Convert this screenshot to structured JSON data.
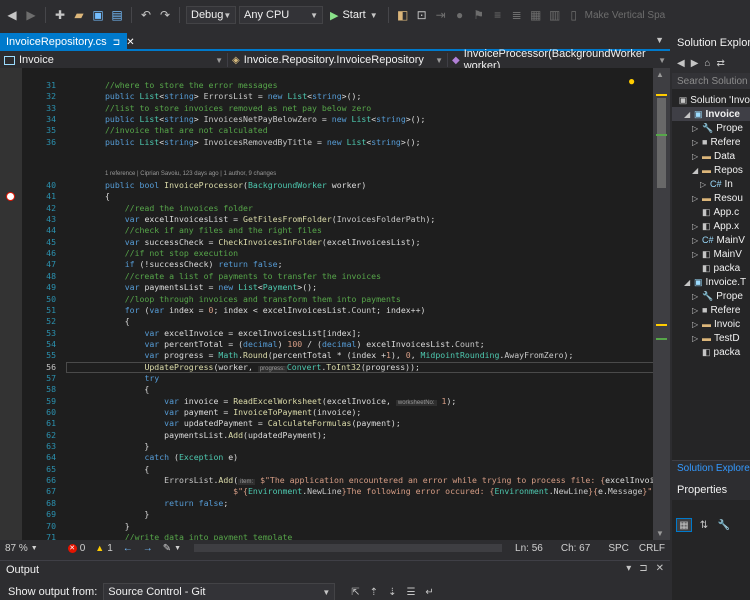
{
  "toolbar": {
    "config": "Debug",
    "platform": "Any CPU",
    "start": "Start",
    "extra": "Make Vertical Spa"
  },
  "tab": {
    "title": "InvoiceRepository.cs"
  },
  "navbar": {
    "project": "Invoice",
    "class": "Invoice.Repository.InvoiceRepository",
    "member": "InvoiceProcessor(BackgroundWorker worker)"
  },
  "editor": {
    "codelens": "1 reference | Ciprian Savoiu, 123 days ago | 1 author, 9 changes",
    "lines": [
      {
        "n": "31",
        "html": "<span class='cm'>//where to store the error messages</span>"
      },
      {
        "n": "32",
        "html": "<span class='kw'>public</span> <span class='ty'>List</span>&lt;<span class='kw'>string</span>&gt; <span class='pr'>ErrorsList</span> = <span class='kw'>new</span> <span class='ty'>List</span>&lt;<span class='kw'>string</span>&gt;();"
      },
      {
        "n": "33",
        "html": "<span class='cm'>//list to store invoices removed as net pay below zero</span>"
      },
      {
        "n": "34",
        "html": "<span class='kw'>public</span> <span class='ty'>List</span>&lt;<span class='kw'>string</span>&gt; <span class='pr'>InvoicesNetPayBelowZero</span> = <span class='kw'>new</span> <span class='ty'>List</span>&lt;<span class='kw'>string</span>&gt;();"
      },
      {
        "n": "35",
        "html": "<span class='cm'>//invoice that are not calculated</span>"
      },
      {
        "n": "36",
        "html": "<span class='kw'>public</span> <span class='ty'>List</span>&lt;<span class='kw'>string</span>&gt; <span class='pr'>InvoicesRemovedByTitle</span> = <span class='kw'>new</span> <span class='ty'>List</span>&lt;<span class='kw'>string</span>&gt;();"
      },
      {
        "n": "37",
        "html": ""
      },
      {
        "n": "38",
        "html": ""
      },
      {
        "n": "39",
        "html": ""
      },
      {
        "n": "40",
        "html": "<span class='kw'>public</span> <span class='kw'>bool</span> <span class='mt'>InvoiceProcessor</span>(<span class='ty'>BackgroundWorker</span> worker)"
      },
      {
        "n": "41",
        "html": "{"
      },
      {
        "n": "42",
        "html": "    <span class='cm'>//read the invoices folder</span>"
      },
      {
        "n": "43",
        "html": "    <span class='kw'>var</span> excelInvoicesList = <span class='mt'>GetFilesFromFolder</span>(<span class='pr'>InvoicesFolderPath</span>);"
      },
      {
        "n": "44",
        "html": "    <span class='cm'>//check if any files and the right files</span>"
      },
      {
        "n": "45",
        "html": "    <span class='kw'>var</span> successCheck = <span class='mt'>CheckInvoicesInFolder</span>(excelInvoicesList);"
      },
      {
        "n": "46",
        "html": "    <span class='cm'>//if not stop execution</span>"
      },
      {
        "n": "47",
        "html": "    <span class='kw'>if</span> (!successCheck) <span class='kw'>return</span> <span class='kw'>false</span>;"
      },
      {
        "n": "48",
        "html": "    <span class='cm'>//create a list of payments to transfer the invoices</span>"
      },
      {
        "n": "49",
        "html": "    <span class='kw'>var</span> paymentsList = <span class='kw'>new</span> <span class='ty'>List</span>&lt;<span class='ty'>Payment</span>&gt;();"
      },
      {
        "n": "50",
        "html": "    <span class='cm'>//loop through invoices and transform them into payments</span>"
      },
      {
        "n": "51",
        "html": "    <span class='kw'>for</span> (<span class='kw'>var</span> index = <span class='st'>0</span>; index &lt; excelInvoicesList.<span class='pr'>Count</span>; index++)"
      },
      {
        "n": "52",
        "html": "    {"
      },
      {
        "n": "53",
        "html": "        <span class='kw'>var</span> excelInvoice = excelInvoicesList[index];"
      },
      {
        "n": "54",
        "html": "        <span class='kw'>var</span> percentTotal = (<span class='kw'>decimal</span>) <span class='st'>100</span> / (<span class='kw'>decimal</span>) excelInvoicesList.<span class='pr'>Count</span>;"
      },
      {
        "n": "55",
        "html": "        <span class='kw'>var</span> progress = <span class='ty'>Math</span>.<span class='mt'>Round</span>(percentTotal * (index +<span class='st'>1</span>), <span class='st'>0</span>, <span class='ty'>MidpointRounding</span>.<span class='pr'>AwayFromZero</span>);"
      },
      {
        "n": "56",
        "html": "        <span class='mt'>UpdateProgress</span>(worker, <span class='hint'>progress:</span><span class='ty'>Convert</span>.<span class='mt'>ToInt32</span>(progress));",
        "cur": true
      },
      {
        "n": "57",
        "html": "        <span class='kw'>try</span>"
      },
      {
        "n": "58",
        "html": "        {"
      },
      {
        "n": "59",
        "html": "            <span class='kw'>var</span> invoice = <span class='mt'>ReadExcelWorksheet</span>(excelInvoice, <span class='hint'>worksheetNo:</span> <span class='st'>1</span>);"
      },
      {
        "n": "60",
        "html": "            <span class='kw'>var</span> payment = <span class='mt'>InvoiceToPayment</span>(invoice);"
      },
      {
        "n": "61",
        "html": "            <span class='kw'>var</span> updatedPayment = <span class='mt'>CalculateFormulas</span>(payment);"
      },
      {
        "n": "62",
        "html": "            paymentsList.<span class='mt'>Add</span>(updatedPayment);"
      },
      {
        "n": "63",
        "html": "        }"
      },
      {
        "n": "64",
        "html": "        <span class='kw'>catch</span> (<span class='ty'>Exception</span> e)"
      },
      {
        "n": "65",
        "html": "        {"
      },
      {
        "n": "66",
        "html": "            <span class='pr'>ErrorsList</span>.<span class='mt'>Add</span>(<span class='hint'>item:</span> <span class='st'>$\"The application encountered an error while trying to process file: {</span>excelInvoic"
      },
      {
        "n": "67",
        "html": "                          <span class='st'>$\"{</span><span class='ty'>Environment</span>.<span class='pr'>NewLine</span><span class='st'>}The following error occured: {</span><span class='ty'>Environment</span>.<span class='pr'>NewLine</span><span class='st'>}{</span>e.<span class='pr'>Message</span><span class='st'>}\"</span>"
      },
      {
        "n": "68",
        "html": "            <span class='kw'>return</span> <span class='kw'>false</span>;"
      },
      {
        "n": "69",
        "html": "        }"
      },
      {
        "n": "70",
        "html": "    }"
      },
      {
        "n": "71",
        "html": "    <span class='cm'>//write data into payment template</span>"
      }
    ]
  },
  "status": {
    "zoom": "87 %",
    "errors": "0",
    "warnings": "1",
    "ln": "Ln: 56",
    "ch": "Ch: 67",
    "spc": "SPC",
    "crlf": "CRLF"
  },
  "output": {
    "title": "Output",
    "show_label": "Show output from:",
    "source": "Source Control - Git"
  },
  "solution_explorer": {
    "title": "Solution Explorer",
    "search": "Search Solution Ex",
    "items": [
      {
        "label": "Solution 'Invo",
        "indent": 0,
        "exp": "",
        "icon": "▣",
        "cls": "cfg"
      },
      {
        "label": "Invoice",
        "indent": 1,
        "exp": "◢",
        "icon": "▣",
        "cls": "cs-c",
        "sel": true
      },
      {
        "label": "Prope",
        "indent": 2,
        "exp": "▷",
        "icon": "🔧",
        "cls": "folder"
      },
      {
        "label": "Refere",
        "indent": 2,
        "exp": "▷",
        "icon": "■",
        "cls": "cfg"
      },
      {
        "label": "Data",
        "indent": 2,
        "exp": "▷",
        "icon": "▬",
        "cls": "folder"
      },
      {
        "label": "Repos",
        "indent": 2,
        "exp": "◢",
        "icon": "▬",
        "cls": "folder"
      },
      {
        "label": "In",
        "indent": 3,
        "exp": "▷",
        "icon": "C#",
        "cls": "cs-c"
      },
      {
        "label": "Resou",
        "indent": 2,
        "exp": "▷",
        "icon": "▬",
        "cls": "folder"
      },
      {
        "label": "App.c",
        "indent": 2,
        "exp": "",
        "icon": "◧",
        "cls": "cfg"
      },
      {
        "label": "App.x",
        "indent": 2,
        "exp": "▷",
        "icon": "◧",
        "cls": "cfg"
      },
      {
        "label": "MainV",
        "indent": 2,
        "exp": "▷",
        "icon": "C#",
        "cls": "cs-c"
      },
      {
        "label": "MainV",
        "indent": 2,
        "exp": "▷",
        "icon": "◧",
        "cls": "cfg"
      },
      {
        "label": "packa",
        "indent": 2,
        "exp": "",
        "icon": "◧",
        "cls": "cfg"
      },
      {
        "label": "Invoice.T",
        "indent": 1,
        "exp": "◢",
        "icon": "▣",
        "cls": "cs-c"
      },
      {
        "label": "Prope",
        "indent": 2,
        "exp": "▷",
        "icon": "🔧",
        "cls": "folder"
      },
      {
        "label": "Refere",
        "indent": 2,
        "exp": "▷",
        "icon": "■",
        "cls": "cfg"
      },
      {
        "label": "Invoic",
        "indent": 2,
        "exp": "▷",
        "icon": "▬",
        "cls": "folder"
      },
      {
        "label": "TestD",
        "indent": 2,
        "exp": "▷",
        "icon": "▬",
        "cls": "folder"
      },
      {
        "label": "packa",
        "indent": 2,
        "exp": "",
        "icon": "◧",
        "cls": "cfg"
      }
    ],
    "footer": "Solution Explorer"
  },
  "properties": {
    "title": "Properties"
  }
}
